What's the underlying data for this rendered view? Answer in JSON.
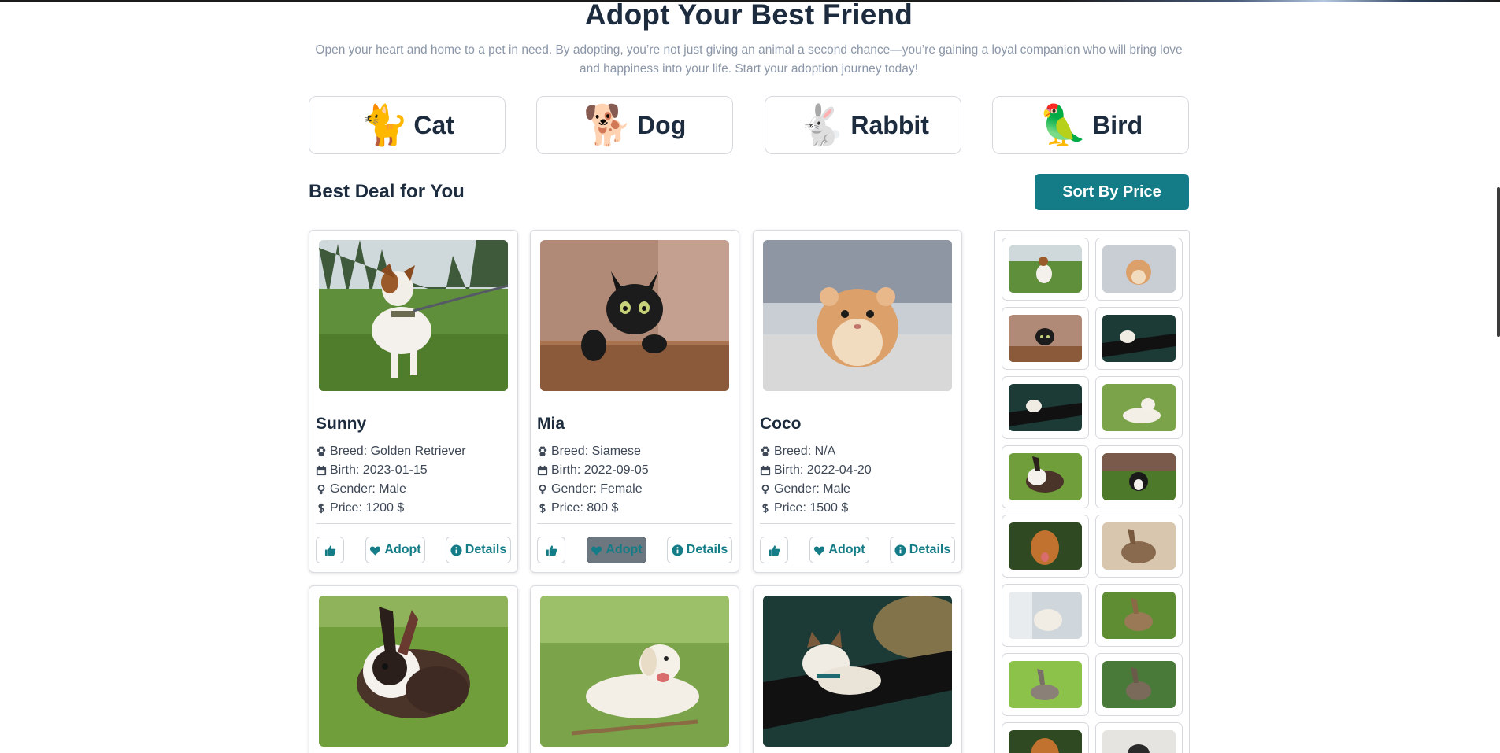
{
  "hero": {
    "title": "Adopt Your Best Friend",
    "subtitle": "Open your heart and home to a pet in need. By adopting, you’re not just giving an animal a second chance—you’re gaining a loyal companion who will bring love and happiness into your life. Start your adoption journey today!"
  },
  "categories": [
    {
      "label": "Cat",
      "emoji": "🐈"
    },
    {
      "label": "Dog",
      "emoji": "🐕"
    },
    {
      "label": "Rabbit",
      "emoji": "🐇"
    },
    {
      "label": "Bird",
      "emoji": "🦜"
    }
  ],
  "section": {
    "title": "Best Deal for You",
    "sort_label": "Sort By Price"
  },
  "pets": [
    {
      "name": "Sunny",
      "breed": "Breed: Golden Retriever",
      "birth": "Birth: 2023-01-15",
      "gender": "Gender: Male",
      "price": "Price: 1200 $",
      "image": "dog-on-grass"
    },
    {
      "name": "Mia",
      "breed": "Breed: Siamese",
      "birth": "Birth: 2022-09-05",
      "gender": "Gender: Female",
      "price": "Price: 800 $",
      "image": "black-cat"
    },
    {
      "name": "Coco",
      "breed": "Breed: N/A",
      "birth": "Birth: 2022-04-20",
      "gender": "Gender: Male",
      "price": "Price: 1500 $",
      "image": "hamster"
    },
    {
      "image": "rabbit-on-grass"
    },
    {
      "image": "white-dog-lying"
    },
    {
      "image": "cat-on-railing"
    }
  ],
  "actions": {
    "adopt": "Adopt",
    "details": "Details"
  },
  "icons": {
    "breed": "paw-icon",
    "birth": "calendar-icon",
    "gender": "gender-icon",
    "price": "dollar-icon",
    "like": "thumbs-up-icon",
    "adopt": "heart-icon",
    "details": "info-icon"
  },
  "colors": {
    "accent": "#137c86",
    "heading": "#1c2b3d",
    "muted": "#8a96a8",
    "adopt_hover": "#6d7780"
  },
  "sidebar_thumbs": [
    "dog-on-grass",
    "hamster",
    "black-cat",
    "cat-on-railing",
    "cat-on-railing",
    "white-dog-lying",
    "rabbit-on-grass",
    "border-collie",
    "golden-dog",
    "brown-rabbit",
    "white-cat-window",
    "brown-rabbit-grass",
    "rabbit-grass-bright",
    "rabbit-grass-dark",
    "golden-dog",
    "dog-partial"
  ]
}
